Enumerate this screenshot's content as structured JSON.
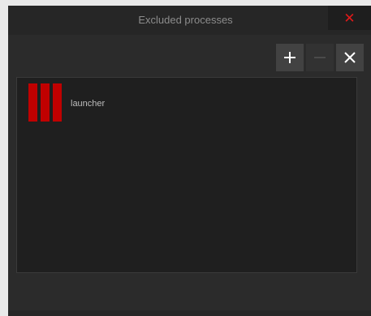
{
  "window": {
    "title": "Excluded processes"
  },
  "icons": {
    "close": "close-icon",
    "add": "plus-icon",
    "remove": "minus-icon",
    "clear": "x-icon",
    "process": "red-bars-app-icon"
  },
  "colors": {
    "accent": "#e01919",
    "app_icon": "#c00000",
    "background": "#2b2b2b",
    "list_background": "#1f1f1f"
  },
  "processes": [
    {
      "name": "launcher"
    }
  ]
}
